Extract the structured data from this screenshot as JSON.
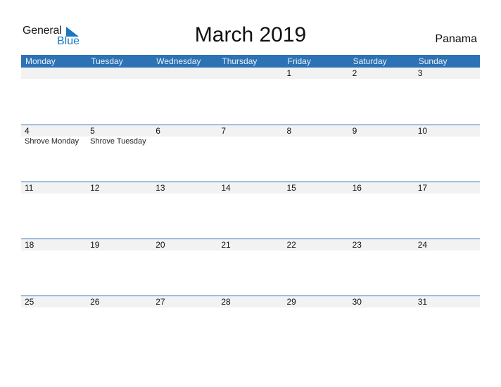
{
  "logo": {
    "part1": "General",
    "part2": "Blue",
    "accent": "#1a78c2"
  },
  "title": "March 2019",
  "country": "Panama",
  "colors": {
    "header_bg": "#2c72b4",
    "strip_bg": "#f2f2f2"
  },
  "weekdays": [
    "Monday",
    "Tuesday",
    "Wednesday",
    "Thursday",
    "Friday",
    "Saturday",
    "Sunday"
  ],
  "weeks": [
    {
      "days": [
        "",
        "",
        "",
        "",
        "1",
        "2",
        "3"
      ],
      "events": [
        "",
        "",
        "",
        "",
        "",
        "",
        ""
      ]
    },
    {
      "days": [
        "4",
        "5",
        "6",
        "7",
        "8",
        "9",
        "10"
      ],
      "events": [
        "Shrove Monday",
        "Shrove Tuesday",
        "",
        "",
        "",
        "",
        ""
      ]
    },
    {
      "days": [
        "11",
        "12",
        "13",
        "14",
        "15",
        "16",
        "17"
      ],
      "events": [
        "",
        "",
        "",
        "",
        "",
        "",
        ""
      ]
    },
    {
      "days": [
        "18",
        "19",
        "20",
        "21",
        "22",
        "23",
        "24"
      ],
      "events": [
        "",
        "",
        "",
        "",
        "",
        "",
        ""
      ]
    },
    {
      "days": [
        "25",
        "26",
        "27",
        "28",
        "29",
        "30",
        "31"
      ],
      "events": [
        "",
        "",
        "",
        "",
        "",
        "",
        ""
      ]
    }
  ]
}
